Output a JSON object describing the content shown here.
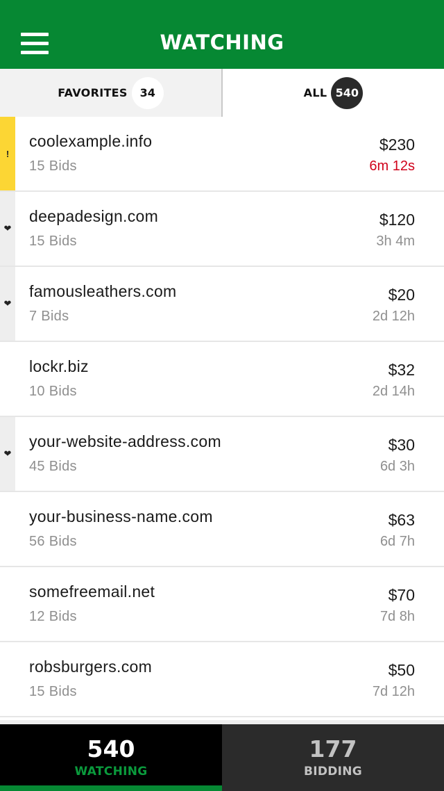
{
  "header": {
    "title": "WATCHING",
    "menu_icon": "hamburger-menu-icon"
  },
  "tabs": [
    {
      "label": "FAVORITES",
      "count": "34",
      "active": false
    },
    {
      "label": "ALL",
      "count": "540",
      "active": true
    }
  ],
  "items": [
    {
      "marker": "alert",
      "marker_glyph": "!",
      "domain": "coolexample.info",
      "bids": "15 Bids",
      "price": "$230",
      "time": "6m 12s",
      "urgent": true
    },
    {
      "marker": "fav",
      "marker_glyph": "❤",
      "domain": "deepadesign.com",
      "bids": "15 Bids",
      "price": "$120",
      "time": "3h 4m",
      "urgent": false
    },
    {
      "marker": "fav",
      "marker_glyph": "❤",
      "domain": "famousleathers.com",
      "bids": "7 Bids",
      "price": "$20",
      "time": "2d 12h",
      "urgent": false
    },
    {
      "marker": "none",
      "marker_glyph": "",
      "domain": "lockr.biz",
      "bids": "10 Bids",
      "price": "$32",
      "time": "2d 14h",
      "urgent": false
    },
    {
      "marker": "fav",
      "marker_glyph": "❤",
      "domain": "your-website-address.com",
      "bids": "45 Bids",
      "price": "$30",
      "time": "6d 3h",
      "urgent": false
    },
    {
      "marker": "none",
      "marker_glyph": "",
      "domain": "your-business-name.com",
      "bids": "56 Bids",
      "price": "$63",
      "time": "6d 7h",
      "urgent": false
    },
    {
      "marker": "none",
      "marker_glyph": "",
      "domain": "somefreemail.net",
      "bids": "12 Bids",
      "price": "$70",
      "time": "7d 8h",
      "urgent": false
    },
    {
      "marker": "none",
      "marker_glyph": "",
      "domain": "robsburgers.com",
      "bids": "15 Bids",
      "price": "$50",
      "time": "7d 12h",
      "urgent": false
    }
  ],
  "footer": {
    "watching": {
      "count": "540",
      "label": "WATCHING",
      "active": true
    },
    "bidding": {
      "count": "177",
      "label": "BIDDING",
      "active": false
    }
  },
  "colors": {
    "brand_green": "#068833",
    "alert_yellow": "#fcd634",
    "urgent_red": "#d0021b"
  }
}
